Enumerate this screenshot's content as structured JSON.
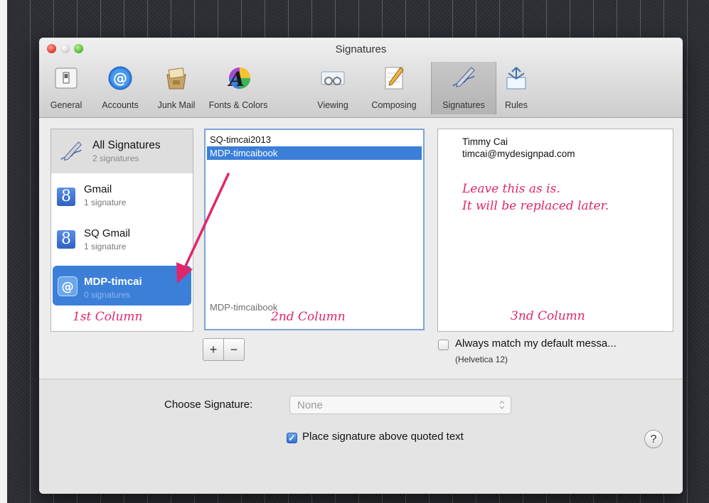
{
  "window": {
    "title": "Signatures"
  },
  "toolbar": {
    "items": [
      {
        "label": "General",
        "icon": "general-switch-icon"
      },
      {
        "label": "Accounts",
        "icon": "at-sign-icon"
      },
      {
        "label": "Junk Mail",
        "icon": "junk-mail-icon"
      },
      {
        "label": "Fonts & Colors",
        "icon": "fonts-colors-icon"
      },
      {
        "label": "Viewing",
        "icon": "viewing-glasses-icon"
      },
      {
        "label": "Composing",
        "icon": "pencil-paper-icon"
      },
      {
        "label": "Signatures",
        "icon": "signature-pen-icon"
      },
      {
        "label": "Rules",
        "icon": "rules-arrows-icon"
      }
    ],
    "selected": "Signatures"
  },
  "accounts": {
    "all": {
      "name": "All Signatures",
      "count": "2 signatures"
    },
    "list": [
      {
        "name": "Gmail",
        "count": "1 signature"
      },
      {
        "name": "SQ Gmail",
        "count": "1 signature"
      },
      {
        "name": "MDP-timcai",
        "count": "0 signatures"
      }
    ]
  },
  "signatures": {
    "items": [
      "SQ-timcai2013",
      "MDP-timcaibook"
    ],
    "selected_index": 1,
    "drag_ghost": "MDP-timcaibook"
  },
  "preview": {
    "name": "Timmy Cai",
    "email": "timcai@mydesignpad.com",
    "note_line1": "Leave this as is.",
    "note_line2": "It will be replaced later."
  },
  "annotations": {
    "col1": "1st Column",
    "col2": "2nd Column",
    "col3": "3nd Column"
  },
  "controls": {
    "add_label": "+",
    "remove_label": "−",
    "always_match_label": "Always match my default messa...",
    "always_match_checked": false,
    "font_hint": "(Helvetica 12)",
    "choose_signature_label": "Choose Signature:",
    "choose_signature_value": "None",
    "place_above_label": "Place signature above quoted text",
    "place_above_checked": true,
    "help_label": "?"
  },
  "colors": {
    "selection_blue": "#3b7fd9",
    "annotation_pink": "#e0266b"
  }
}
